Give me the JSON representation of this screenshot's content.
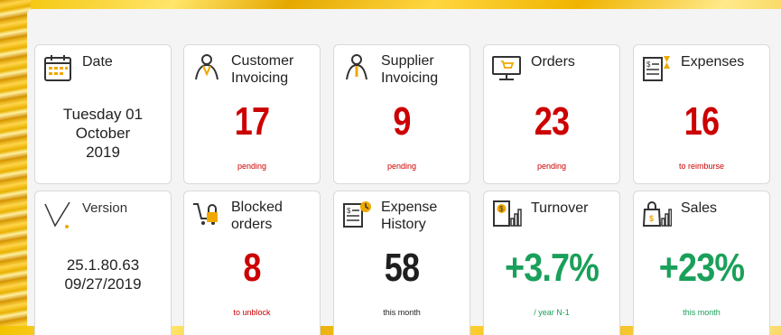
{
  "cards": {
    "date": {
      "title": "Date",
      "line1": "Tuesday 01",
      "line2": "October",
      "line3": "2019"
    },
    "customer_invoicing": {
      "title1": "Customer",
      "title2": "Invoicing",
      "value": "17",
      "sub": "pending"
    },
    "supplier_invoicing": {
      "title1": "Supplier",
      "title2": "Invoicing",
      "value": "9",
      "sub": "pending"
    },
    "orders": {
      "title": "Orders",
      "value": "23",
      "sub": "pending"
    },
    "expenses": {
      "title": "Expenses",
      "value": "16",
      "sub": "to reimburse"
    },
    "version": {
      "title": "Version",
      "line1": "25.1.80.63",
      "line2": "09/27/2019"
    },
    "blocked_orders": {
      "title1": "Blocked",
      "title2": "orders",
      "value": "8",
      "sub": "to unblock"
    },
    "expense_history": {
      "title1": "Expense",
      "title2": "History",
      "value": "58",
      "sub": "this month"
    },
    "turnover": {
      "title": "Turnover",
      "value": "+3.7%",
      "sub": "/ year N-1"
    },
    "sales": {
      "title": "Sales",
      "value": "+23%",
      "sub": "this month"
    }
  },
  "colors": {
    "alert": "#cc0000",
    "positive": "#1aa05a",
    "neutral": "#1f1f1f",
    "accent": "#f0a800"
  }
}
